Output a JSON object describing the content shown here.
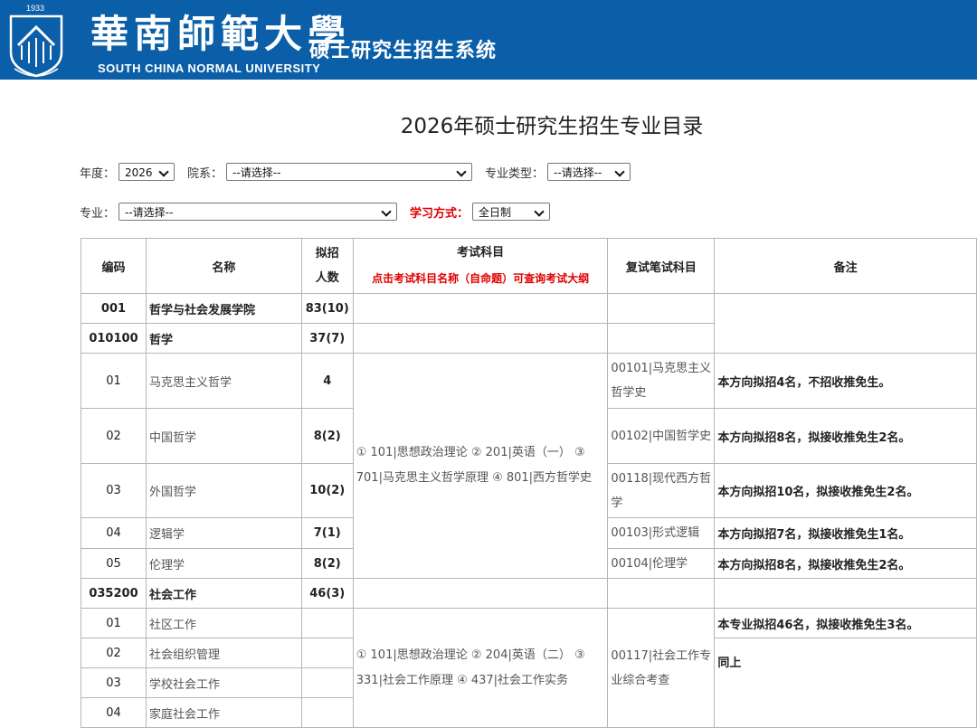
{
  "header": {
    "year_badge": "1933",
    "cn_name": "華南師範大學",
    "system_name": "硕士研究生招生系统",
    "en_name": "SOUTH CHINA NORMAL UNIVERSITY"
  },
  "page_title": "2026年硕士研究生招生专业目录",
  "filters": {
    "year_label": "年度：",
    "year_value": "2026",
    "dept_label": "院系：",
    "dept_value": "--请选择--",
    "type_label": "专业类型：",
    "type_value": "--请选择--",
    "major_label": "专业：",
    "major_value": "--请选择--",
    "mode_label": "学习方式：",
    "mode_value": "全日制"
  },
  "table": {
    "headers": {
      "code": "编码",
      "name": "名称",
      "quota_1": "拟招",
      "quota_2": "人数",
      "exam": "考试科目",
      "exam_note": "点击考试科目名称（自命题）可查询考试大纲",
      "retest": "复试笔试科目",
      "remark": "备注"
    },
    "college": {
      "code": "001",
      "name": "哲学与社会发展学院",
      "quota": "83(10)"
    },
    "philosophy": {
      "code": "010100",
      "name": "哲学",
      "quota": "37(7)",
      "exam": "① 101|思想政治理论 ② 201|英语（一） ③ 701|马克思主义哲学原理 ④ 801|西方哲学史",
      "rows": [
        {
          "code": "01",
          "name": "马克思主义哲学",
          "quota": "4",
          "retest": "00101|马克思主义哲学史",
          "remark": "本方向拟招4名，不招收推免生。"
        },
        {
          "code": "02",
          "name": "中国哲学",
          "quota": "8(2)",
          "retest": "00102|中国哲学史",
          "remark": "本方向拟招8名，拟接收推免生2名。"
        },
        {
          "code": "03",
          "name": "外国哲学",
          "quota": "10(2)",
          "retest": "00118|现代西方哲学",
          "remark": "本方向拟招10名，拟接收推免生2名。"
        },
        {
          "code": "04",
          "name": "逻辑学",
          "quota": "7(1)",
          "retest": "00103|形式逻辑",
          "remark": "本方向拟招7名，拟接收推免生1名。"
        },
        {
          "code": "05",
          "name": "伦理学",
          "quota": "8(2)",
          "retest": "00104|伦理学",
          "remark": "本方向拟招8名，拟接收推免生2名。"
        }
      ]
    },
    "social_work": {
      "code": "035200",
      "name": "社会工作",
      "quota": "46(3)",
      "exam": "① 101|思想政治理论 ② 204|英语（二） ③ 331|社会工作原理 ④ 437|社会工作实务",
      "retest": "00117|社会工作专业综合考查",
      "remark_first": "本专业拟招46名，拟接收推免生3名。",
      "remark_rest": "同上",
      "rows": [
        {
          "code": "01",
          "name": "社区工作"
        },
        {
          "code": "02",
          "name": "社会组织管理"
        },
        {
          "code": "03",
          "name": "学校社会工作"
        },
        {
          "code": "04",
          "name": "家庭社会工作"
        }
      ]
    }
  }
}
